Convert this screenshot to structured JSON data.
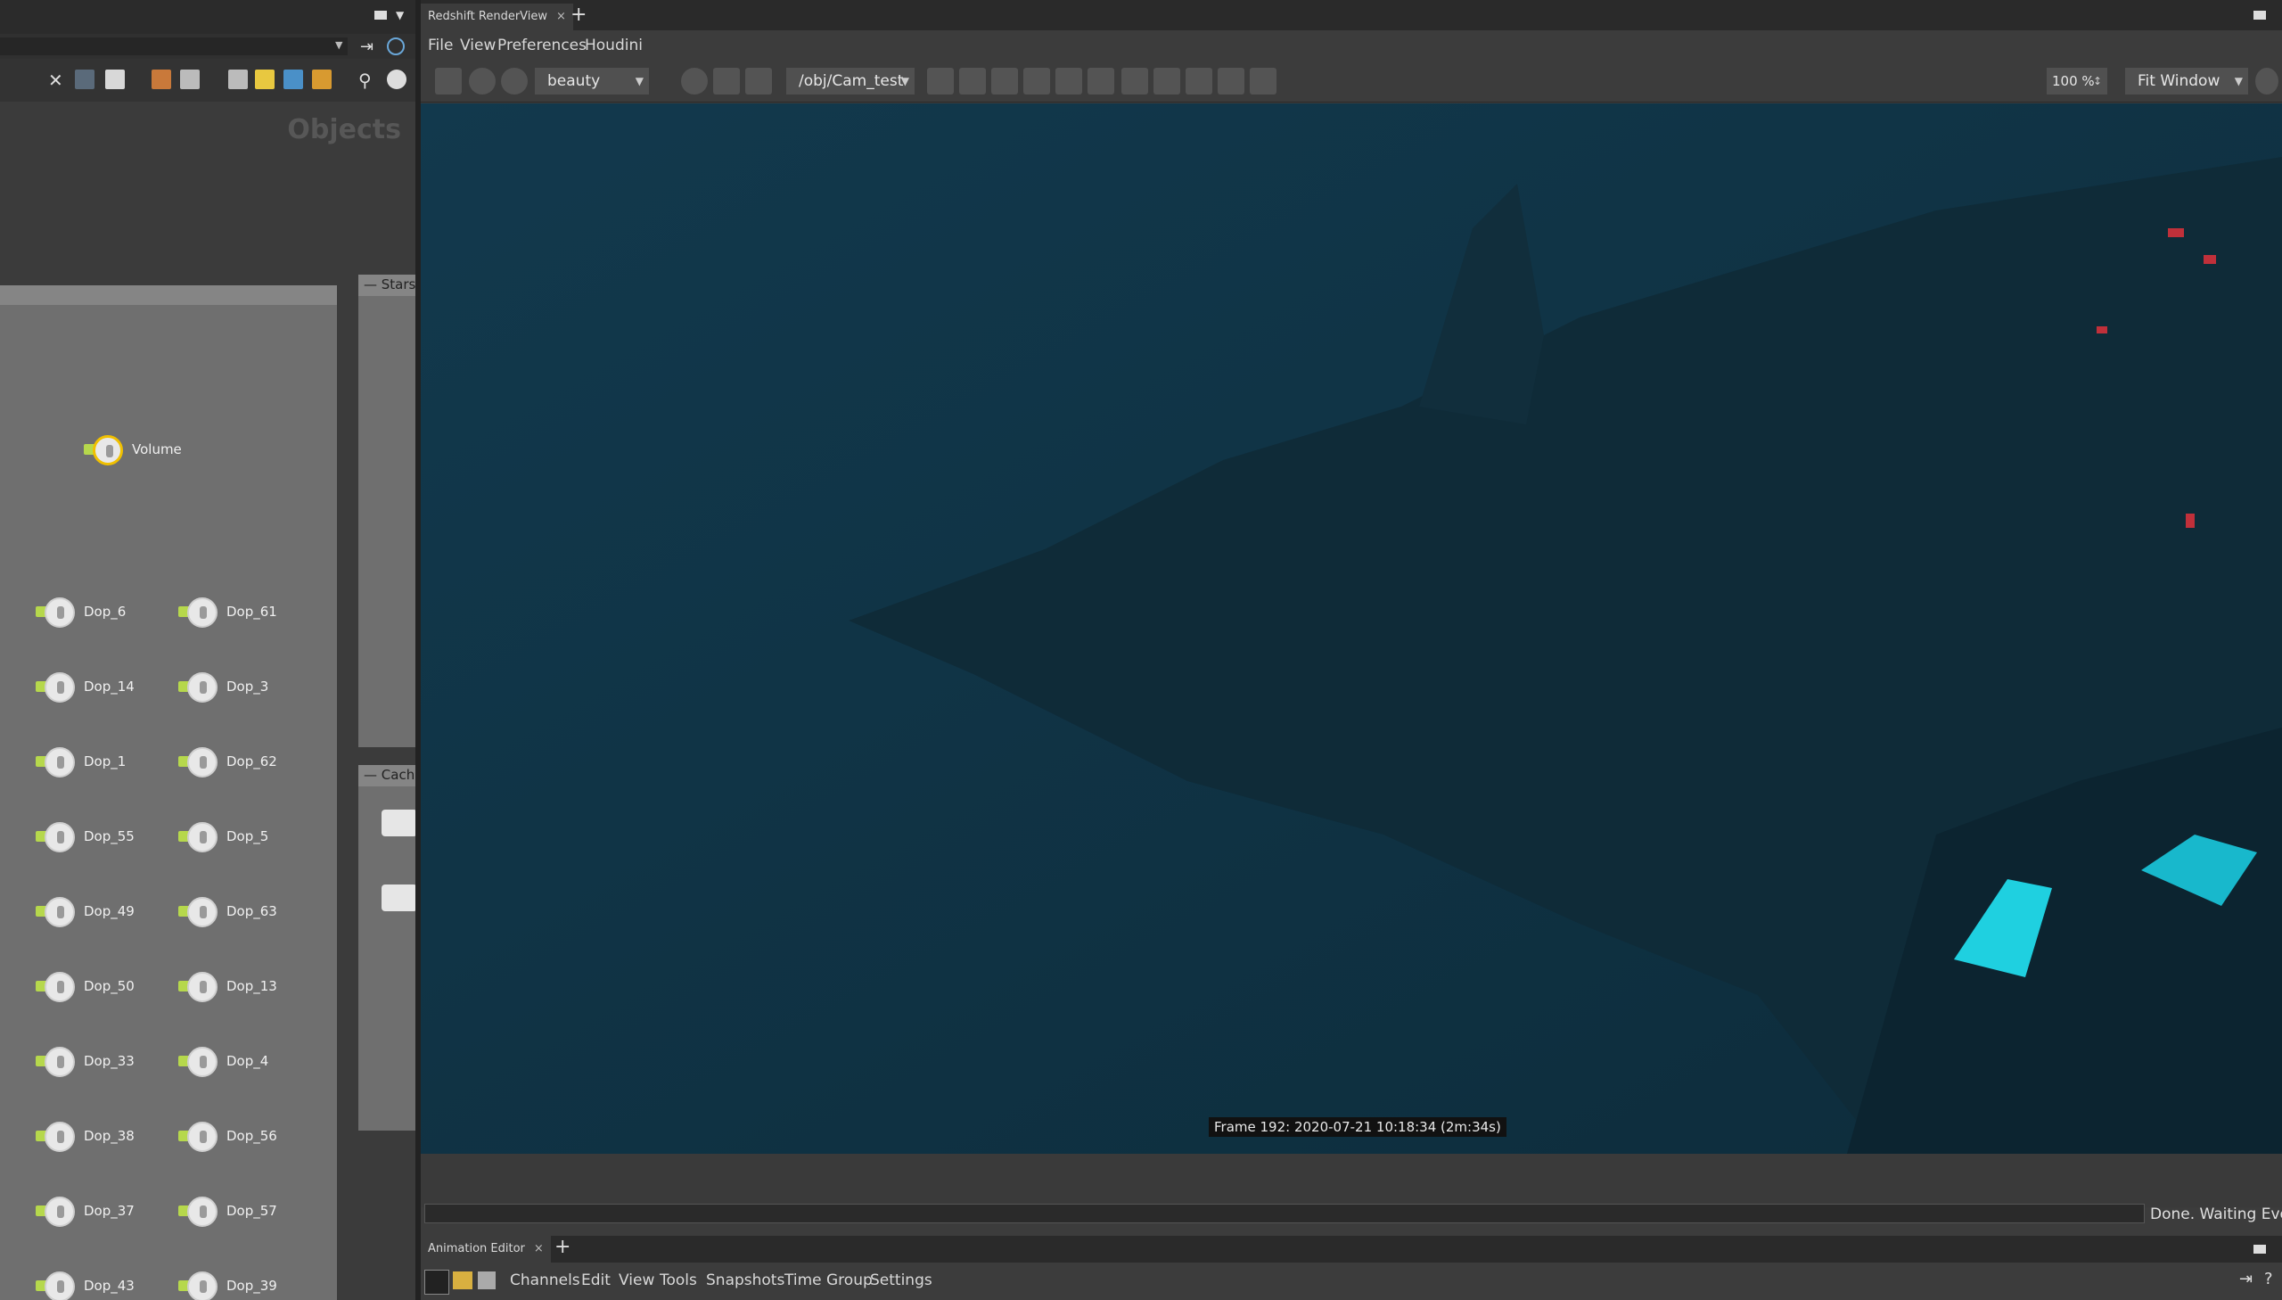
{
  "left_pane": {
    "objects_label": "Objects",
    "boxes": {
      "stars": "Stars",
      "cache": "Cache"
    },
    "selected_node": "Volume",
    "nodes_col1": [
      "Dop_6",
      "Dop_14",
      "Dop_1",
      "Dop_55",
      "Dop_49",
      "Dop_50",
      "Dop_33",
      "Dop_38",
      "Dop_37",
      "Dop_43"
    ],
    "nodes_col2": [
      "Dop_61",
      "Dop_3",
      "Dop_62",
      "Dop_5",
      "Dop_63",
      "Dop_13",
      "Dop_4",
      "Dop_56",
      "Dop_57",
      "Dop_39"
    ]
  },
  "render_view": {
    "tab_label": "Redshift RenderView",
    "menu": [
      "File",
      "View",
      "Preferences",
      "Houdini"
    ],
    "aov": "beauty",
    "camera": "/obj/Cam_test",
    "zoom": "100 %",
    "fit": "Fit Window",
    "frame_info": "Frame  192:  2020-07-21  10:18:34  (2m:34s)",
    "status": "Done. Waiting Event"
  },
  "animation_editor": {
    "tab_label": "Animation Editor",
    "menu": [
      "Channels",
      "Edit",
      "View",
      "Tools",
      "Snapshots",
      "Time Group",
      "Settings"
    ]
  },
  "colors": {
    "render_bg": "#163a4c",
    "node_plug": "#b6d84c",
    "selected_outline": "#f0c000"
  }
}
